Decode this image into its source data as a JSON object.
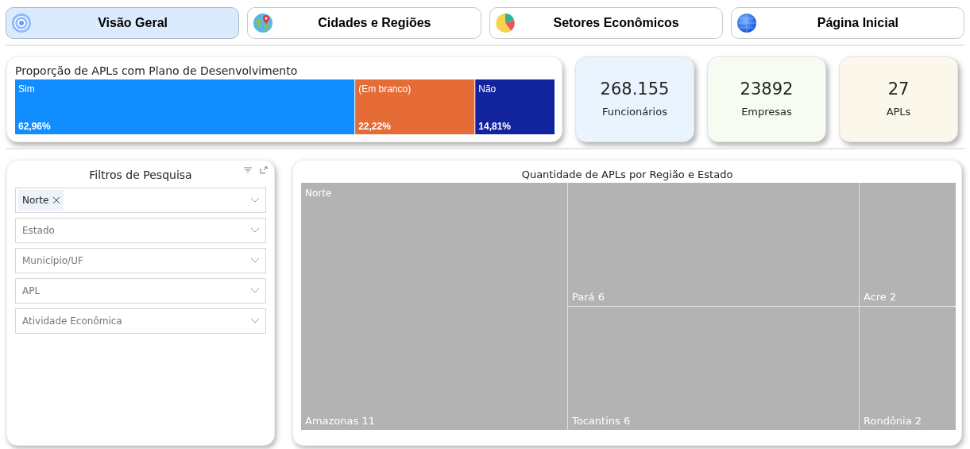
{
  "nav": [
    {
      "label": "Visão Geral",
      "kind": "target",
      "selected": true
    },
    {
      "label": "Cidades e Regiões",
      "kind": "globe",
      "selected": false
    },
    {
      "label": "Setores Econômicos",
      "kind": "pie",
      "selected": false
    },
    {
      "label": "Página Inicial",
      "kind": "sphere",
      "selected": false
    }
  ],
  "proportion": {
    "chart_data": {
      "type": "bar",
      "orientation": "horizontal",
      "stacked": true,
      "title": "Proporção de APLs com Plano de Desenvolvimento",
      "series": [
        {
          "name": "Sim",
          "color": "#118dff",
          "values": [
            62.96
          ],
          "value_labels": [
            "62,96%"
          ]
        },
        {
          "name": "(Em branco)",
          "color": "#e66c37",
          "values": [
            22.22
          ],
          "value_labels": [
            "22,22%"
          ]
        },
        {
          "name": "Não",
          "color": "#12239e",
          "values": [
            14.81
          ],
          "value_labels": [
            "14,81%"
          ]
        }
      ]
    }
  },
  "kpis": [
    {
      "value": "268.155",
      "label": "Funcionários",
      "color": "#eaf4fe"
    },
    {
      "value": "23892",
      "label": "Empresas",
      "color": "#f6fcf2"
    },
    {
      "value": "27",
      "label": "APLs",
      "color": "#fbf8eb"
    }
  ],
  "filters": {
    "title": "Filtros de Pesquisa",
    "fields": [
      {
        "chips": [
          "Norte"
        ]
      },
      {
        "placeholder": "Estado"
      },
      {
        "placeholder": "Município/UF"
      },
      {
        "placeholder": "APL"
      },
      {
        "placeholder": "Atividade Econômica"
      }
    ]
  },
  "treemap": {
    "title": "Quantidade de APLs por Região e Estado",
    "region": "Norte",
    "tiles": [
      {
        "label": "Amazonas 11"
      },
      {
        "label": "Pará 6"
      },
      {
        "label": "Tocantins 6"
      },
      {
        "label": "Acre 2"
      },
      {
        "label": "Rondônia 2"
      }
    ]
  }
}
